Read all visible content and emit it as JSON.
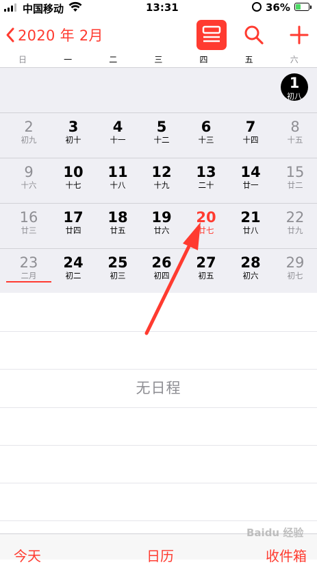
{
  "status_bar": {
    "carrier": "中国移动",
    "time": "13:31",
    "battery": "36%"
  },
  "nav": {
    "back_label": "2020 年 2月",
    "list_icon": "list-view-icon",
    "search_icon": "search-icon",
    "add_icon": "plus-icon"
  },
  "weekdays": [
    "日",
    "一",
    "二",
    "三",
    "四",
    "五",
    "六"
  ],
  "calendar": {
    "rows": [
      [
        {
          "day": "",
          "lunar": ""
        },
        {
          "day": "",
          "lunar": ""
        },
        {
          "day": "",
          "lunar": ""
        },
        {
          "day": "",
          "lunar": ""
        },
        {
          "day": "",
          "lunar": ""
        },
        {
          "day": "",
          "lunar": ""
        },
        {
          "day": "1",
          "lunar": "初八",
          "selected": true
        }
      ],
      [
        {
          "day": "2",
          "lunar": "初九"
        },
        {
          "day": "3",
          "lunar": "初十"
        },
        {
          "day": "4",
          "lunar": "十一"
        },
        {
          "day": "5",
          "lunar": "十二"
        },
        {
          "day": "6",
          "lunar": "十三"
        },
        {
          "day": "7",
          "lunar": "十四"
        },
        {
          "day": "8",
          "lunar": "十五"
        }
      ],
      [
        {
          "day": "9",
          "lunar": "十六"
        },
        {
          "day": "10",
          "lunar": "十七"
        },
        {
          "day": "11",
          "lunar": "十八"
        },
        {
          "day": "12",
          "lunar": "十九"
        },
        {
          "day": "13",
          "lunar": "二十"
        },
        {
          "day": "14",
          "lunar": "廿一"
        },
        {
          "day": "15",
          "lunar": "廿二"
        }
      ],
      [
        {
          "day": "16",
          "lunar": "廿三"
        },
        {
          "day": "17",
          "lunar": "廿四"
        },
        {
          "day": "18",
          "lunar": "廿五"
        },
        {
          "day": "19",
          "lunar": "廿六"
        },
        {
          "day": "20",
          "lunar": "廿七",
          "today": true
        },
        {
          "day": "21",
          "lunar": "廿八"
        },
        {
          "day": "22",
          "lunar": "廿九"
        }
      ],
      [
        {
          "day": "23",
          "lunar": "二月",
          "month_mark": true
        },
        {
          "day": "24",
          "lunar": "初二"
        },
        {
          "day": "25",
          "lunar": "初三"
        },
        {
          "day": "26",
          "lunar": "初四"
        },
        {
          "day": "27",
          "lunar": "初五"
        },
        {
          "day": "28",
          "lunar": "初六"
        },
        {
          "day": "29",
          "lunar": "初七"
        }
      ]
    ]
  },
  "events": {
    "empty_text": "无日程"
  },
  "tabbar": {
    "today": "今天",
    "calendars": "日历",
    "inbox": "收件箱"
  },
  "watermark": "Baidu 经验",
  "colors": {
    "accent": "#ff3b30",
    "calendar_bg": "#efeff4",
    "secondary_text": "#8e8e93"
  }
}
